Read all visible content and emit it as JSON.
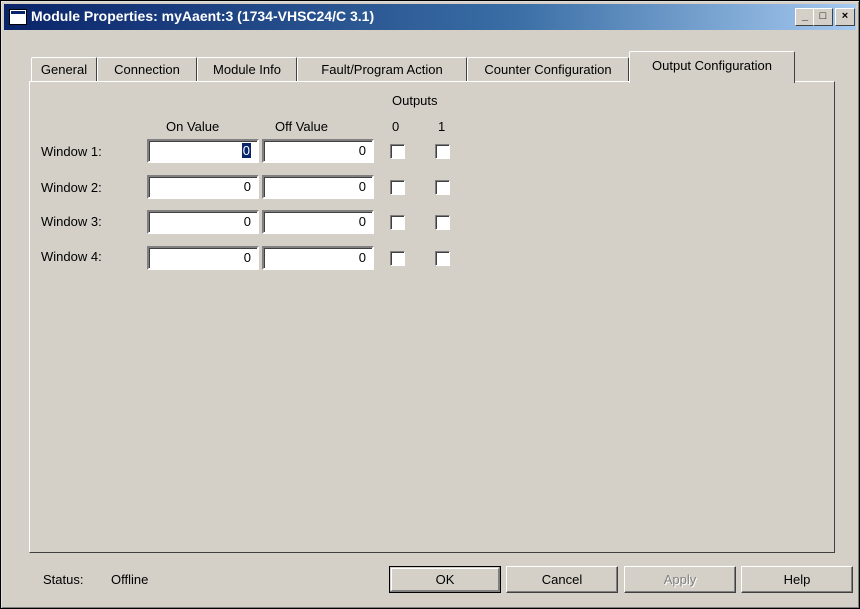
{
  "window": {
    "title": "Module Properties: myAaent:3 (1734-VHSC24/C 3.1)",
    "controls": {
      "minimize": "_",
      "maximize": "□",
      "close": "×"
    }
  },
  "tabs": [
    {
      "label": "General",
      "active": false
    },
    {
      "label": "Connection",
      "active": false
    },
    {
      "label": "Module Info",
      "active": false
    },
    {
      "label": "Fault/Program Action",
      "active": false
    },
    {
      "label": "Counter Configuration",
      "active": false
    },
    {
      "label": "Output Configuration",
      "active": true
    }
  ],
  "output_config": {
    "outputs_header": "Outputs",
    "on_value_header": "On Value",
    "off_value_header": "Off Value",
    "output_cols": [
      "0",
      "1"
    ],
    "windows": [
      {
        "label": "Window 1:",
        "on_value": "0",
        "off_value": "0",
        "out0": false,
        "out1": false
      },
      {
        "label": "Window 2:",
        "on_value": "0",
        "off_value": "0",
        "out0": false,
        "out1": false
      },
      {
        "label": "Window 3:",
        "on_value": "0",
        "off_value": "0",
        "out0": false,
        "out1": false
      },
      {
        "label": "Window 4:",
        "on_value": "0",
        "off_value": "0",
        "out0": false,
        "out1": false
      }
    ]
  },
  "status": {
    "label": "Status:",
    "value": "Offline"
  },
  "buttons": {
    "ok": "OK",
    "cancel": "Cancel",
    "apply": "Apply",
    "help": "Help"
  }
}
